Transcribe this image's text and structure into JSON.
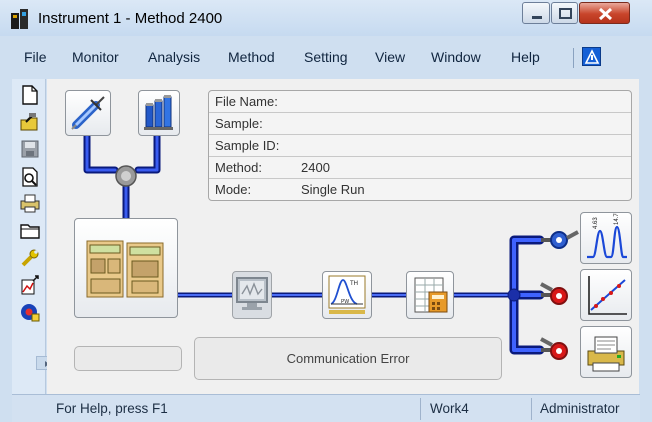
{
  "window": {
    "title": "Instrument 1 - Method  2400",
    "caption_buttons": [
      "minimize",
      "maximize",
      "close"
    ]
  },
  "menu": {
    "items": [
      "File",
      "Monitor",
      "Analysis",
      "Method",
      "Setting",
      "View",
      "Window",
      "Help"
    ],
    "icon": "instrument-status-icon"
  },
  "toolbar": {
    "icons": [
      "new-file-icon",
      "open-file-icon",
      "save-icon",
      "print-preview-icon",
      "print-icon",
      "open-folder-icon",
      "wrench-icon",
      "chart-export-icon",
      "instrument-status-icon"
    ]
  },
  "info": {
    "rows": [
      {
        "label": "File Name:",
        "value": ""
      },
      {
        "label": "Sample:",
        "value": ""
      },
      {
        "label": "Sample ID:",
        "value": ""
      },
      {
        "label": "Method:",
        "value": "2400"
      },
      {
        "label": "Mode:",
        "value": "Single Run"
      }
    ]
  },
  "status": {
    "error_text": "Communication Error",
    "help_text": "For Help, press F1",
    "workspace": "Work4",
    "user": "Administrator"
  },
  "flow": {
    "line_color": "#1632c8",
    "valve_colors": {
      "top": "#2f5fd0",
      "middle": "#d81818",
      "bottom": "#d81818"
    }
  }
}
